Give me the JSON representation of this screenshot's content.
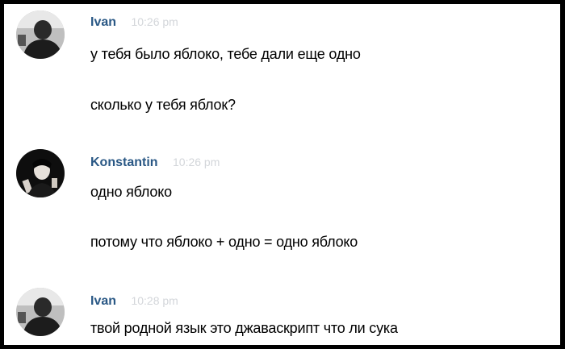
{
  "messages": [
    {
      "author": "Ivan",
      "time": "10:26 pm",
      "avatar_icon": "user-avatar-ivan",
      "lines": [
        "у тебя было яблоко, тебе дали еще одно",
        "сколько у тебя яблок?"
      ]
    },
    {
      "author": "Konstantin",
      "time": "10:26 pm",
      "avatar_icon": "user-avatar-konstantin",
      "lines": [
        "одно яблоко",
        "потому что яблоко + одно = одно яблоко"
      ]
    },
    {
      "author": "Ivan",
      "time": "10:28 pm",
      "avatar_icon": "user-avatar-ivan",
      "lines": [
        "твой родной язык это джаваскрипт что ли сука"
      ]
    }
  ],
  "colors": {
    "author": "#2a5885",
    "time": "#d3d6da",
    "text": "#000000",
    "border": "#000000",
    "background": "#ffffff"
  }
}
